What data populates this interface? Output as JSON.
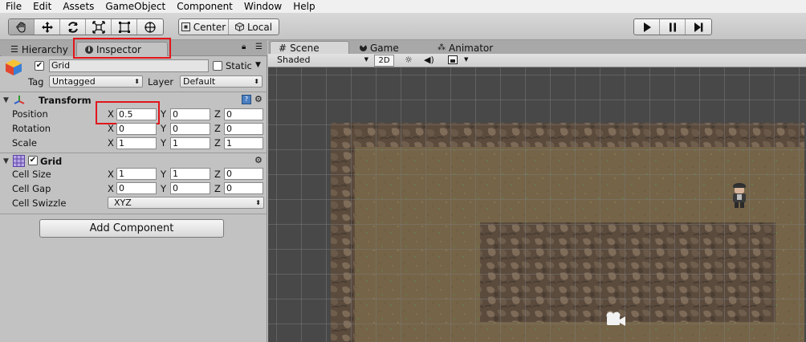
{
  "menu": [
    "File",
    "Edit",
    "Assets",
    "GameObject",
    "Component",
    "Window",
    "Help"
  ],
  "toolbar": {
    "tools": [
      "hand-tool-icon",
      "move-tool-icon",
      "rotate-tool-icon",
      "scale-tool-icon",
      "rect-tool-icon",
      "transform-tool-icon"
    ],
    "pivot_label": "Center",
    "space_label": "Local",
    "play_icons": [
      "play-icon",
      "pause-icon",
      "step-icon"
    ]
  },
  "left_tabs": {
    "hierarchy": "Hierarchy",
    "inspector": "Inspector"
  },
  "inspector": {
    "object_name": "Grid",
    "static_label": "Static",
    "tag_label": "Tag",
    "tag_value": "Untagged",
    "layer_label": "Layer",
    "layer_value": "Default",
    "transform": {
      "title": "Transform",
      "position_label": "Position",
      "rotation_label": "Rotation",
      "scale_label": "Scale",
      "axis_x": "X",
      "axis_y": "Y",
      "axis_z": "Z",
      "position": {
        "x": "0.5",
        "y": "0",
        "z": "0"
      },
      "rotation": {
        "x": "0",
        "y": "0",
        "z": "0"
      },
      "scale": {
        "x": "1",
        "y": "1",
        "z": "1"
      }
    },
    "grid": {
      "title": "Grid",
      "cell_size_label": "Cell Size",
      "cell_gap_label": "Cell Gap",
      "cell_swizzle_label": "Cell Swizzle",
      "cell_size": {
        "x": "1",
        "y": "1",
        "z": "0"
      },
      "cell_gap": {
        "x": "0",
        "y": "0",
        "z": "0"
      },
      "cell_swizzle": "XYZ"
    },
    "add_component": "Add Component"
  },
  "scene_tabs": {
    "scene": "Scene",
    "game": "Game",
    "animator": "Animator"
  },
  "scene_options": {
    "shading": "Shaded",
    "mode_2d": "2D"
  },
  "colors": {
    "highlight": "#e0161b",
    "viewport_bg": "#4a4a4a",
    "ground": "#6b5a3e",
    "wall": "#5a4a3a"
  }
}
